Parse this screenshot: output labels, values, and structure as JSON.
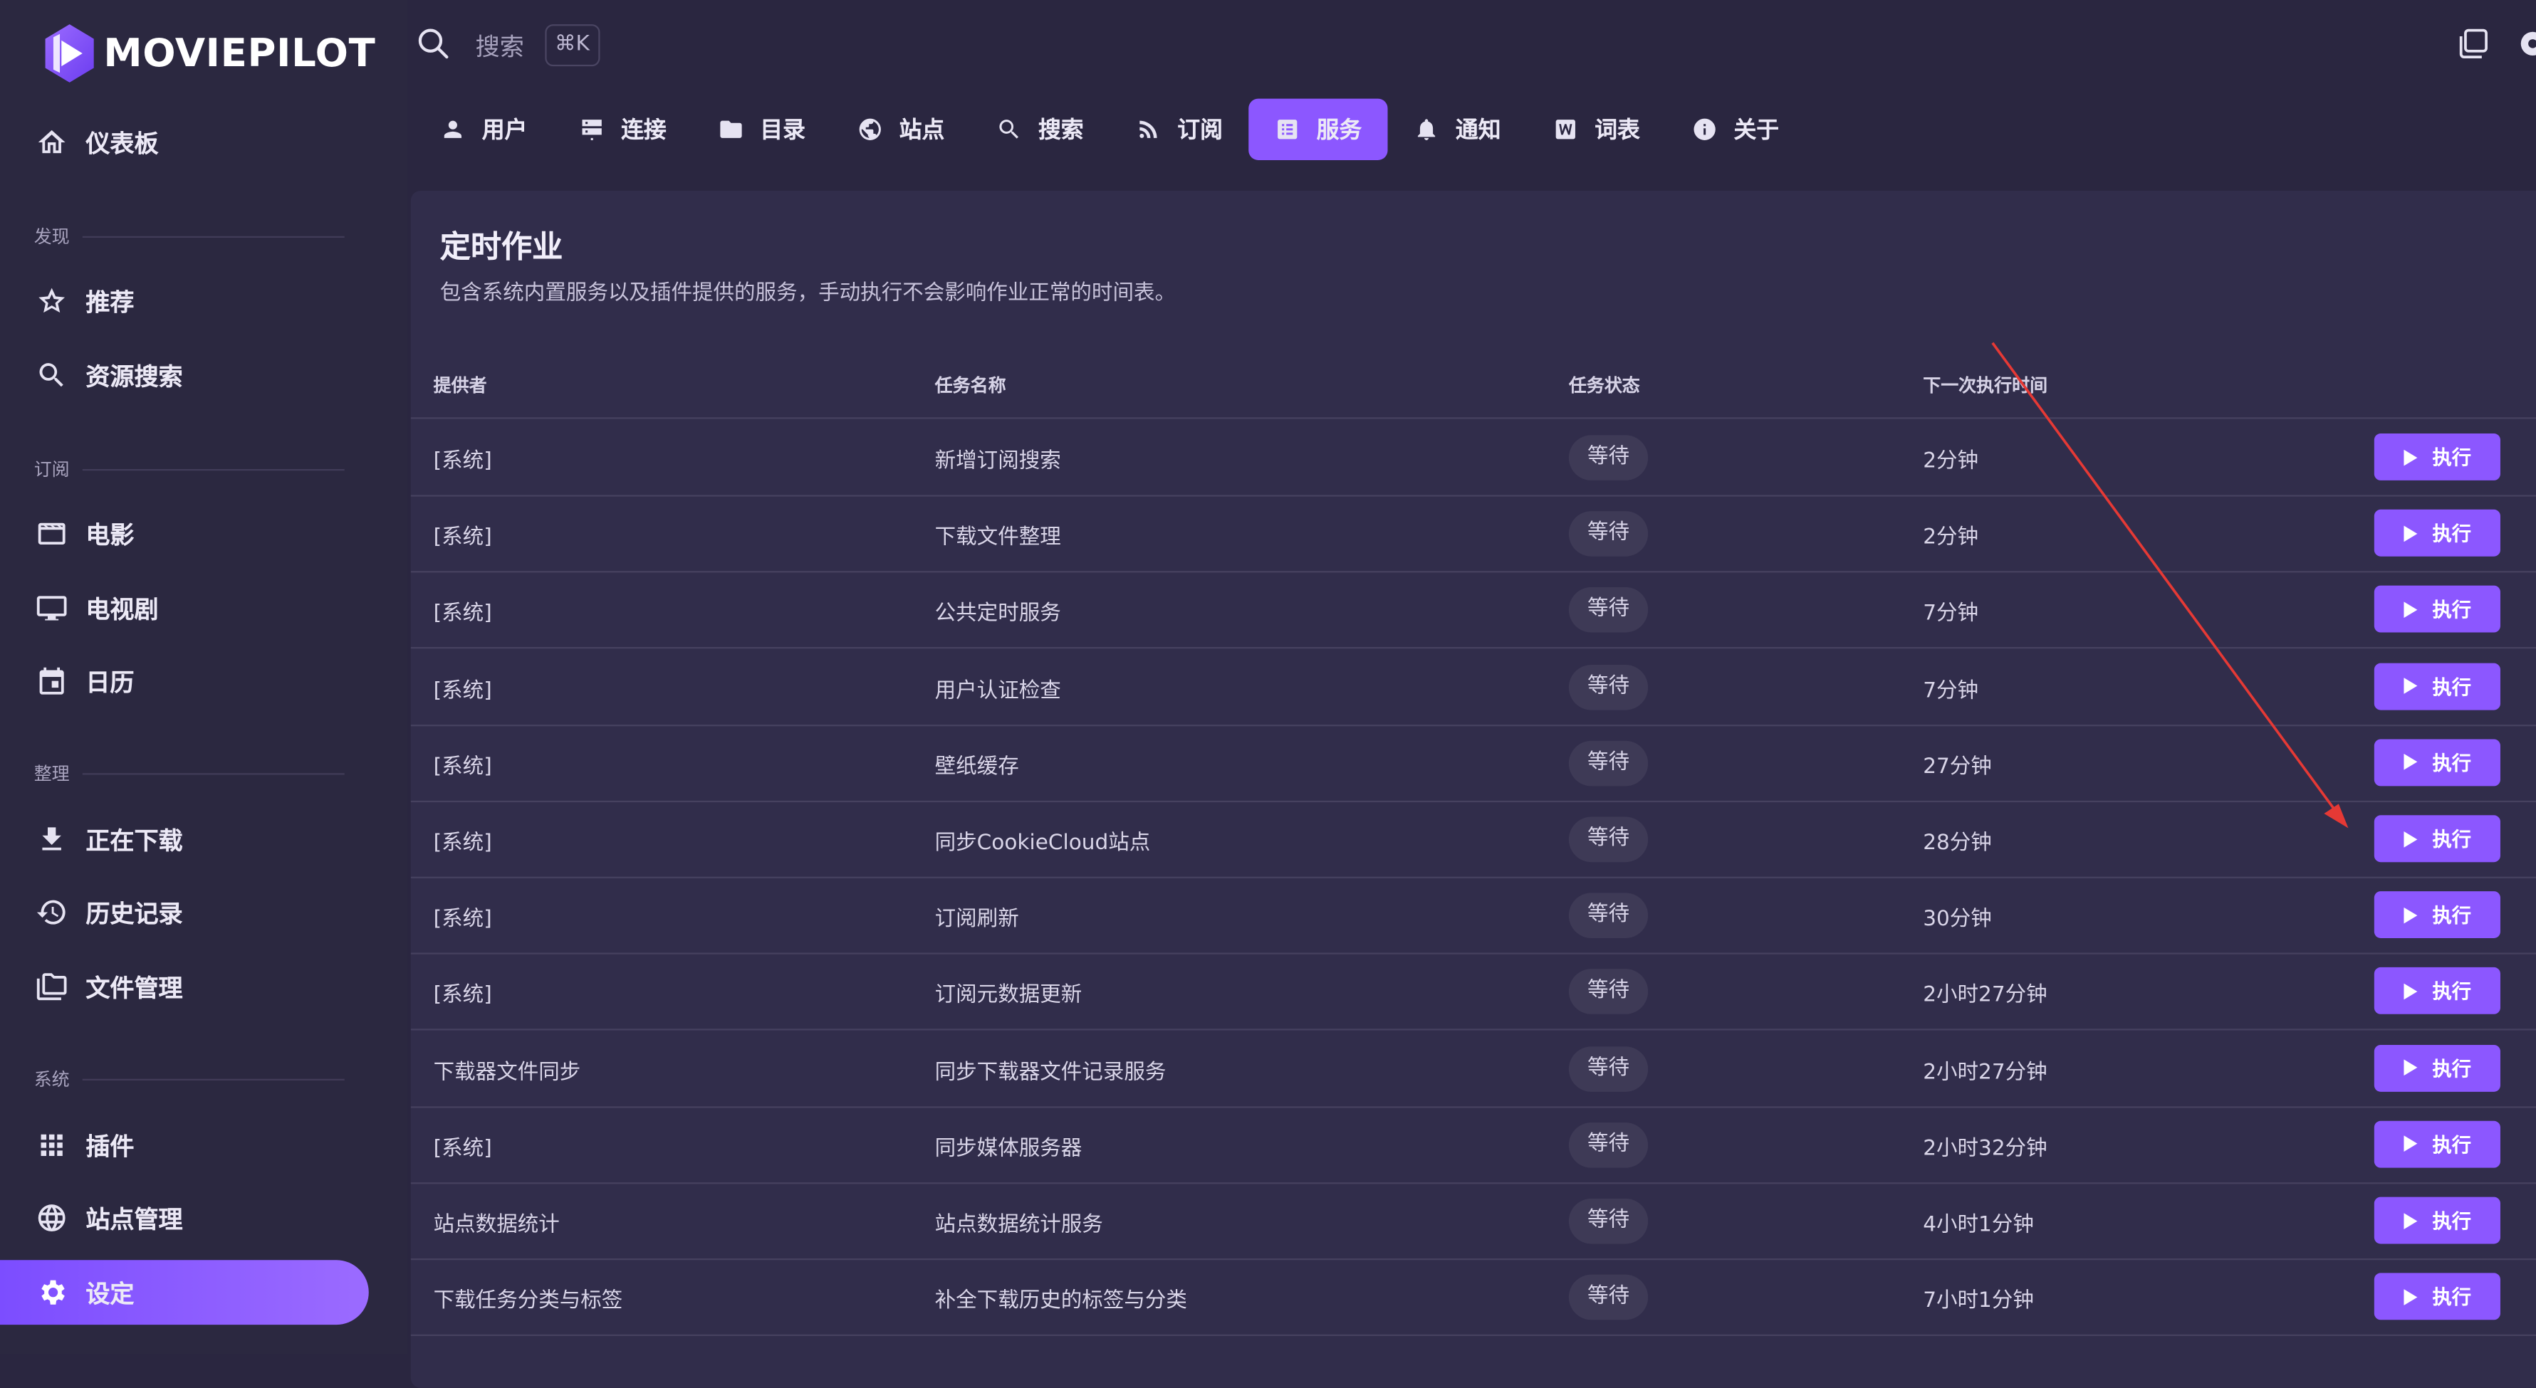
{
  "app": {
    "logo_text": "MOVIEPILOT"
  },
  "search": {
    "label": "搜索",
    "shortcut": "⌘K"
  },
  "sidebar": {
    "dashboard": "仪表板",
    "sections": [
      "发现",
      "订阅",
      "整理",
      "系统"
    ],
    "discover": [
      "推荐",
      "资源搜索"
    ],
    "subscribe": [
      "电影",
      "电视剧",
      "日历"
    ],
    "organize": [
      "正在下载",
      "历史记录",
      "文件管理"
    ],
    "system": [
      "插件",
      "站点管理",
      "设定"
    ]
  },
  "tabs": [
    "用户",
    "连接",
    "目录",
    "站点",
    "搜索",
    "订阅",
    "服务",
    "通知",
    "词表",
    "关于"
  ],
  "active_tab": "服务",
  "card": {
    "title": "定时作业",
    "subtitle": "包含系统内置服务以及插件提供的服务，手动执行不会影响作业正常的时间表。"
  },
  "table": {
    "headers": [
      "提供者",
      "任务名称",
      "任务状态",
      "下一次执行时间"
    ],
    "button_label": "执行",
    "rows": [
      {
        "provider": "[系统]",
        "name": "新增订阅搜索",
        "status": "等待",
        "next": "2分钟"
      },
      {
        "provider": "[系统]",
        "name": "下载文件整理",
        "status": "等待",
        "next": "2分钟"
      },
      {
        "provider": "[系统]",
        "name": "公共定时服务",
        "status": "等待",
        "next": "7分钟"
      },
      {
        "provider": "[系统]",
        "name": "用户认证检查",
        "status": "等待",
        "next": "7分钟"
      },
      {
        "provider": "[系统]",
        "name": "壁纸缓存",
        "status": "等待",
        "next": "27分钟"
      },
      {
        "provider": "[系统]",
        "name": "同步CookieCloud站点",
        "status": "等待",
        "next": "28分钟"
      },
      {
        "provider": "[系统]",
        "name": "订阅刷新",
        "status": "等待",
        "next": "30分钟"
      },
      {
        "provider": "[系统]",
        "name": "订阅元数据更新",
        "status": "等待",
        "next": "2小时27分钟"
      },
      {
        "provider": "下载器文件同步",
        "name": "同步下载器文件记录服务",
        "status": "等待",
        "next": "2小时27分钟"
      },
      {
        "provider": "[系统]",
        "name": "同步媒体服务器",
        "status": "等待",
        "next": "2小时32分钟"
      },
      {
        "provider": "站点数据统计",
        "name": "站点数据统计服务",
        "status": "等待",
        "next": "4小时1分钟"
      },
      {
        "provider": "下载任务分类与标签",
        "name": "补全下载历史的标签与分类",
        "status": "等待",
        "next": "7小时1分钟"
      }
    ]
  },
  "colors": {
    "accent": "#8c57ff",
    "background": "#2a2640",
    "card": "#312d4b",
    "annotation": "#e53935"
  }
}
